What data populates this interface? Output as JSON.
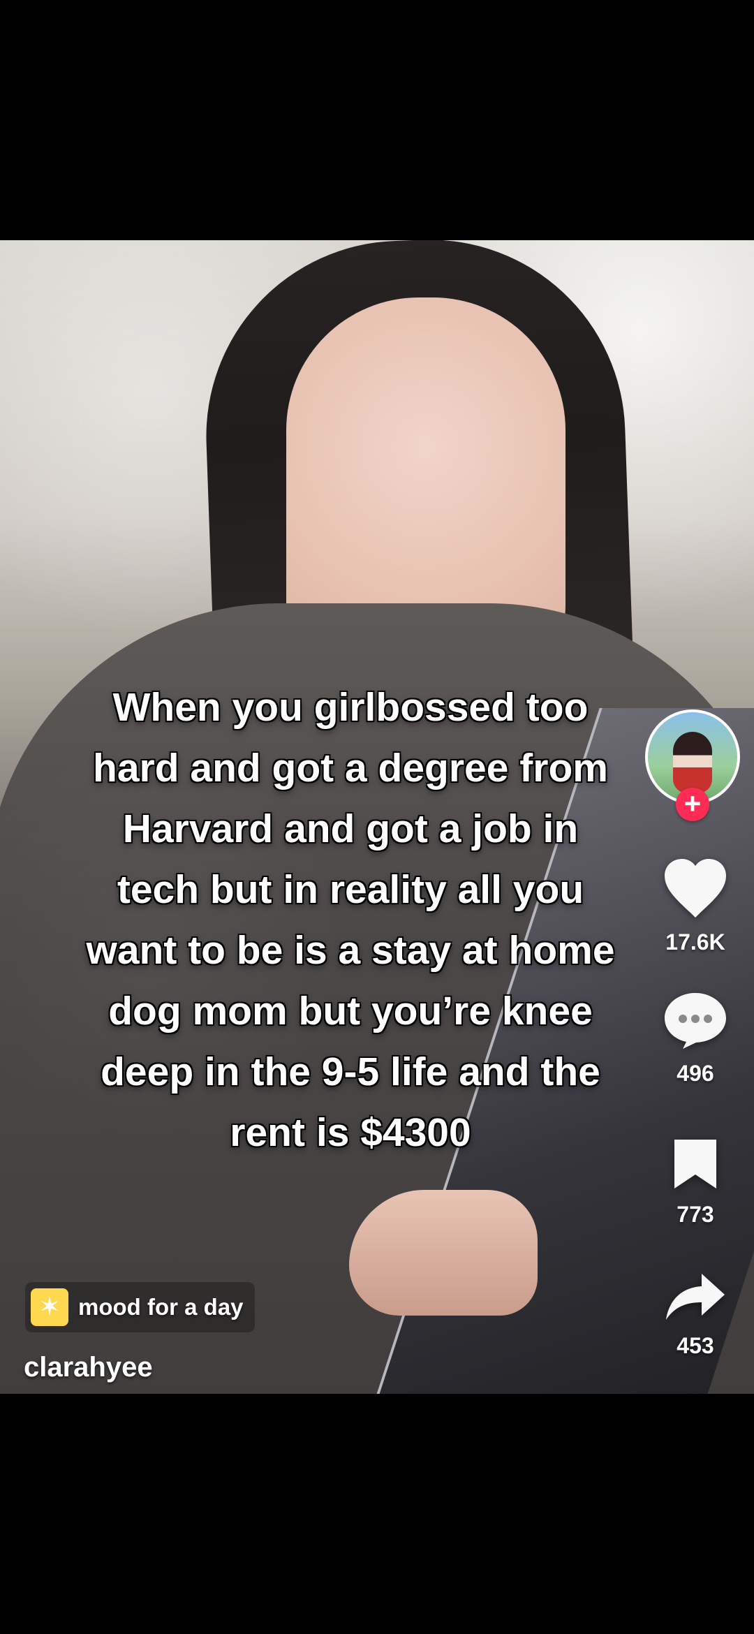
{
  "video": {
    "caption": "When you girlbossed too\nhard and got a degree from\nHarvard and got a job in\ntech but in reality all you\nwant to be is a stay at home\ndog mom but you’re knee\ndeep in the 9-5 life and the\nrent is $4300",
    "username": "clarahyee",
    "sound_label": "mood for a day"
  },
  "actions": {
    "follow_plus": "+",
    "likes": "17.6K",
    "comments": "496",
    "bookmarks": "773",
    "shares": "453"
  },
  "icons": {
    "avatar": "profile-avatar",
    "follow": "plus-icon",
    "like": "heart-icon",
    "comment": "speech-bubble-icon",
    "bookmark": "bookmark-icon",
    "share": "share-arrow-icon",
    "sound": "sparkle-icon"
  },
  "colors": {
    "accent": "#fe2c55",
    "sound_icon_bg": "#ffd84f",
    "text": "#ffffff",
    "background": "#000000"
  }
}
